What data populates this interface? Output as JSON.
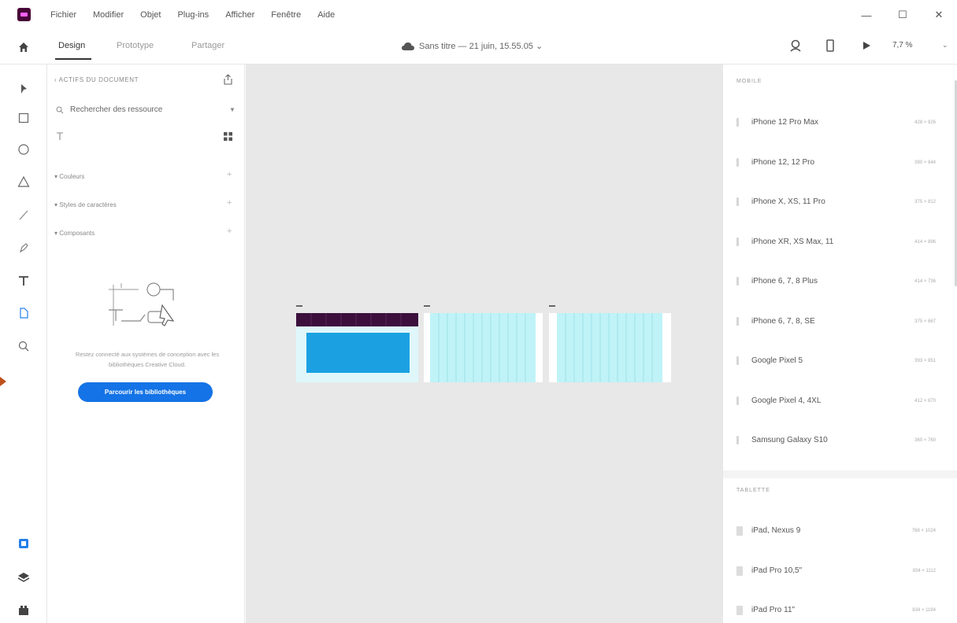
{
  "menu": {
    "items": [
      "Fichier",
      "Modifier",
      "Objet",
      "Plug-ins",
      "Afficher",
      "Fenêtre",
      "Aide"
    ],
    "window_controls": [
      "—",
      "☐",
      "✕"
    ]
  },
  "toolbar": {
    "tabs": [
      "Design",
      "Prototype",
      "Partager"
    ],
    "active_tab": "Design",
    "doc_title": "Sans titre — 21 juin, 15.55.05 ⌄",
    "zoom": "7,7 %",
    "zoom_caret": "⌄"
  },
  "assets": {
    "heading": "‹ ACTIFS DU DOCUMENT",
    "search_placeholder": "Rechercher des ressource",
    "sections": [
      {
        "label": "▾ Couleurs",
        "plus": "+"
      },
      {
        "label": "▾ Styles de caractères",
        "plus": "+"
      },
      {
        "label": "▾ Composants",
        "plus": "+"
      }
    ],
    "empty_text": "Restez connecté aux systèmes de conception avec les bibliothèques Creative Cloud.",
    "browse_button": "Parcourir les bibliothèques"
  },
  "canvas": {
    "header_color": "#3c0f3c",
    "fill_color": "#1ba1e2",
    "grid_color": "#bff3f7"
  },
  "presets": {
    "mobile_title": "MOBILE",
    "mobile": [
      {
        "name": "iPhone 12 Pro Max",
        "size": "428 × 926"
      },
      {
        "name": "iPhone 12, 12 Pro",
        "size": "390 × 844"
      },
      {
        "name": "iPhone X, XS, 11 Pro",
        "size": "375 × 812"
      },
      {
        "name": "iPhone XR, XS Max, 11",
        "size": "414 × 896"
      },
      {
        "name": "iPhone 6, 7, 8 Plus",
        "size": "414 × 736"
      },
      {
        "name": "iPhone 6, 7, 8, SE",
        "size": "375 × 667"
      },
      {
        "name": "Google Pixel 5",
        "size": "393 × 851"
      },
      {
        "name": "Google Pixel 4, 4XL",
        "size": "412 × 870"
      },
      {
        "name": "Samsung Galaxy S10",
        "size": "360 × 760"
      }
    ],
    "tablet_title": "TABLETTE",
    "tablet": [
      {
        "name": "iPad, Nexus 9",
        "size": "768 × 1024"
      },
      {
        "name": "iPad Pro 10,5\"",
        "size": "834 × 1112"
      },
      {
        "name": "iPad Pro 11\"",
        "size": "834 × 1194"
      }
    ]
  }
}
